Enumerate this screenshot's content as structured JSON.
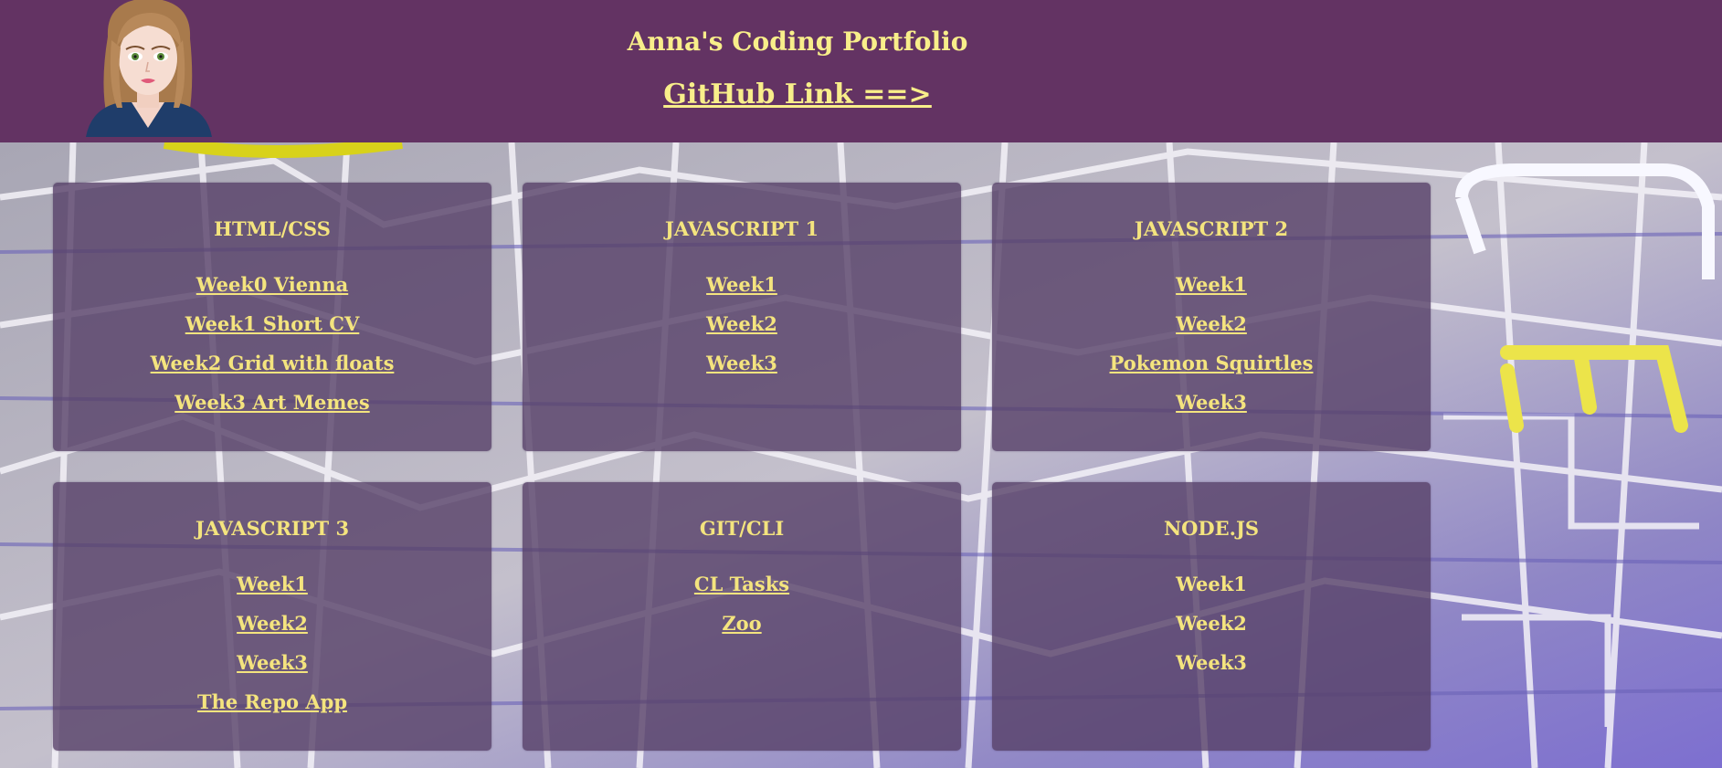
{
  "header": {
    "title": "Anna's Coding Portfolio",
    "github_link": "GitHub Link ==>"
  },
  "colors": {
    "header_bg": "#633363",
    "accent_text": "#f8ee8a",
    "card_bg": "#564068"
  },
  "sections": [
    {
      "title": "HTML/CSS",
      "links": [
        "Week0 Vienna",
        "Week1 Short CV",
        "Week2 Grid with floats",
        "Week3 Art Memes"
      ]
    },
    {
      "title": "JAVASCRIPT 1",
      "links": [
        "Week1",
        "Week2",
        "Week3"
      ]
    },
    {
      "title": "JAVASCRIPT 2",
      "links": [
        "Week1",
        "Week2",
        "Pokemon Squirtles",
        "Week3"
      ]
    },
    {
      "title": "JAVASCRIPT 3",
      "links": [
        "Week1",
        "Week2",
        "Week3",
        "The Repo App"
      ]
    },
    {
      "title": "GIT/CLI",
      "links": [
        "CL Tasks",
        "Zoo"
      ]
    },
    {
      "title": "NODE.JS",
      "links": [
        "Week1",
        "Week2",
        "Week3"
      ],
      "plain": true
    }
  ]
}
